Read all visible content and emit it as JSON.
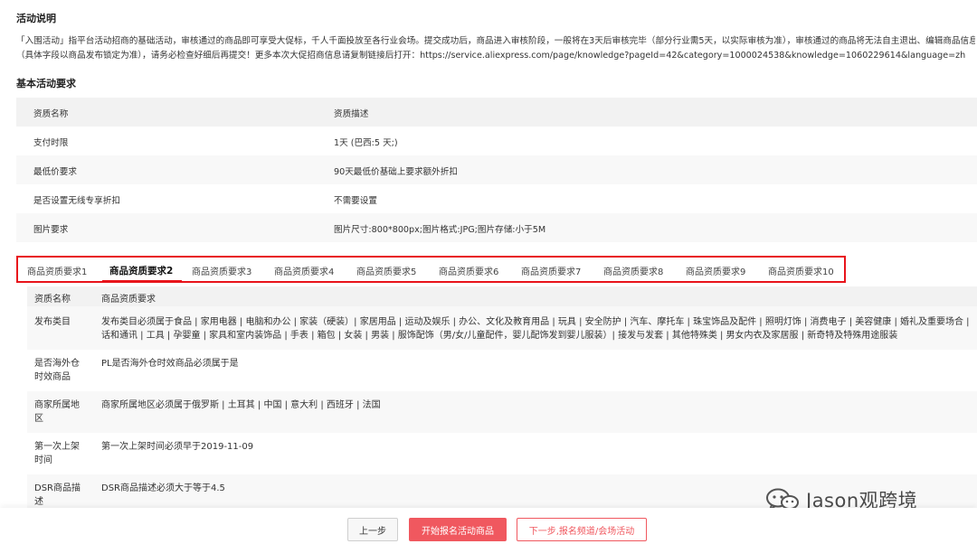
{
  "activity": {
    "title": "活动说明",
    "lines": [
      "「入围活动」指平台活动招商的基础活动，审核通过的商品即可享受大促标，千人千面投放至各行业会场。提交成功后，商品进入审核阶段，一般将在3天后审核完毕（部分行业需5天，以实际审核为准），审核通过的商品将无法自主退出、编辑商品信息",
      "（具体字段以商品发布锁定为准），请务必检查好细后再提交！更多本次大促招商信息请复制链接后打开：https://service.aliexpress.com/page/knowledge?pageId=42&category=1000024538&knowledge=1060229614&language=zh"
    ]
  },
  "basic": {
    "title": "基本活动要求",
    "header": {
      "name": "资质名称",
      "desc": "资质描述"
    },
    "rows": [
      {
        "name": "支付时限",
        "desc": "1天 (巴西:5 天;)"
      },
      {
        "name": "最低价要求",
        "desc": "90天最低价基础上要求额外折扣"
      },
      {
        "name": "是否设置无线专享折扣",
        "desc": "不需要设置"
      },
      {
        "name": "图片要求",
        "desc": "图片尺寸:800*800px;图片格式:JPG;图片存储:小于5M"
      }
    ]
  },
  "tabs": [
    "商品资质要求1",
    "商品资质要求2",
    "商品资质要求3",
    "商品资质要求4",
    "商品资质要求5",
    "商品资质要求6",
    "商品资质要求7",
    "商品资质要求8",
    "商品资质要求9",
    "商品资质要求10"
  ],
  "active_tab": 2,
  "requirements": {
    "header": {
      "name": "资质名称",
      "desc": "商品资质要求"
    },
    "rows": [
      {
        "name": "发布类目",
        "desc": [
          "发布类目必须属于食品 | 家用电器 | 电脑和办公 | 家装（硬装）| 家居用品 | 运动及娱乐 | 办公、文化及教育用品 | 玩具 | 安全防护 | 汽车、摩托车 | 珠宝饰品及配件 | 照明灯饰 | 消费电子 | 美容健康 | 婚礼及重要场合 | 鞋子 | 电子元器件 | 电",
          "话和通讯 | 工具 | 孕婴童 | 家具和室内装饰品 | 手表 | 箱包 | 女装 | 男装 | 服饰配饰（男/女/儿童配件，婴儿配饰发到婴儿服装）| 接发与发套 | 其他特殊类 | 男女内衣及家居服 | 新奇特及特殊用途服装"
        ]
      },
      {
        "name": [
          "是否海外仓",
          "时效商品"
        ],
        "desc": [
          "PL是否海外仓时效商品必须属于是"
        ]
      },
      {
        "name": [
          "商家所属地",
          "区"
        ],
        "desc": [
          "商家所属地区必须属于俄罗斯 | 土耳其 | 中国 | 意大利 | 西班牙 | 法国"
        ]
      },
      {
        "name": [
          "第一次上架",
          "时间"
        ],
        "desc": [
          "第一次上架时间必须早于2019-11-09"
        ]
      },
      {
        "name": [
          "DSR商品描",
          "述"
        ],
        "desc": [
          "DSR商品描述必须大于等于4.5"
        ]
      }
    ]
  },
  "footer": {
    "prev_label": "上一步",
    "start_label": "开始报名活动商品",
    "next_label": "下一步,报名频道/会场活动"
  },
  "watermark": {
    "text": "Jason观跨境"
  },
  "colors": {
    "accent": "#e8141b",
    "primary_button": "#f0585f",
    "row_alt": "#f8f8f8"
  }
}
